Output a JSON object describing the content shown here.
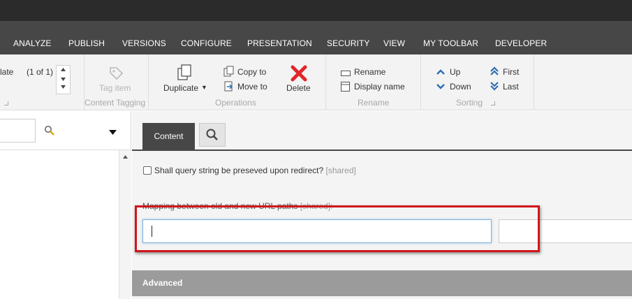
{
  "menu": {
    "tabs": [
      {
        "label": "ANALYZE"
      },
      {
        "label": "PUBLISH"
      },
      {
        "label": "VERSIONS"
      },
      {
        "label": "CONFIGURE"
      },
      {
        "label": "PRESENTATION"
      },
      {
        "label": "SECURITY"
      },
      {
        "label": "VIEW"
      },
      {
        "label": "MY TOOLBAR"
      },
      {
        "label": "DEVELOPER"
      }
    ]
  },
  "ribbon": {
    "template_text": "late",
    "template_count": "(1 of 1)",
    "tag_item": "Tag item",
    "content_tagging": "Content Tagging",
    "duplicate": "Duplicate",
    "copy_to": "Copy to",
    "move_to": "Move to",
    "delete": "Delete",
    "operations": "Operations",
    "rename": "Rename",
    "display_name": "Display name",
    "rename_group": "Rename",
    "up": "Up",
    "down": "Down",
    "first": "First",
    "last": "Last",
    "sorting": "Sorting",
    "delete_color": "#e0262b",
    "sort_color": "#2d6fb5"
  },
  "content": {
    "tab_content": "Content",
    "checkbox_label": "Shall query string be preseved upon redirect?",
    "shared_tag": "[shared]",
    "mapping_label": "Mapping between old and new URL paths",
    "mapping_shared": "[shared]:",
    "old_path_value": "",
    "new_path_value": "",
    "advanced": "Advanced",
    "highlight_color": "#d0161b"
  }
}
